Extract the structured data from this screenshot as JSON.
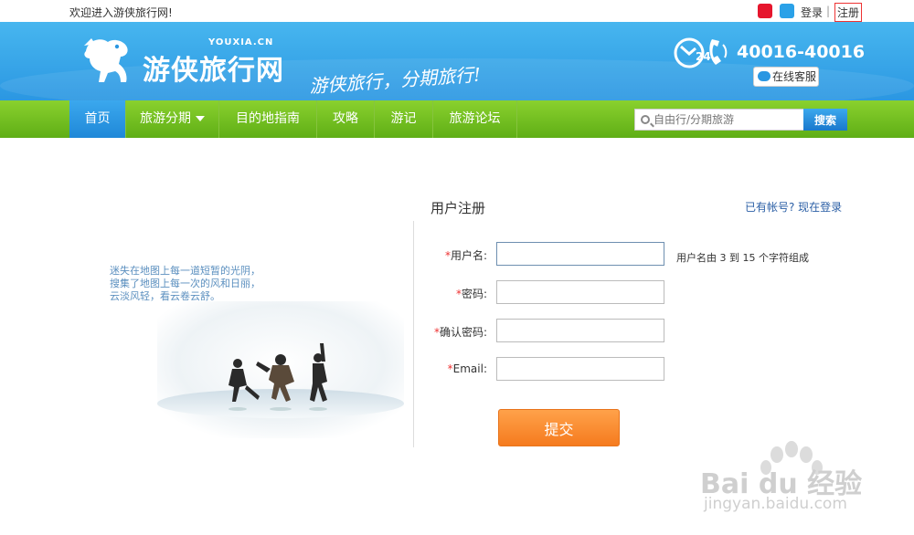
{
  "topbar": {
    "welcome": "欢迎进入游侠旅行网!",
    "login": "登录",
    "separator": "|",
    "register": "注册"
  },
  "header": {
    "logo_sub": "YOUXIA.CN",
    "logo_text": "游侠旅行网",
    "slogan": "游侠旅行，分期旅行!",
    "phone": "40016-40016",
    "phone_badge": "24",
    "service": "在线客服"
  },
  "nav": {
    "items": [
      "首页",
      "旅游分期",
      "目的地指南",
      "攻略",
      "游记",
      "旅游论坛"
    ],
    "search_placeholder": "自由行/分期旅游",
    "search_button": "搜索"
  },
  "promo": {
    "lines": [
      "迷失在地图上每一道短暂的光阴，",
      "搜集了地图上每一次的风和日丽，",
      "云淡风轻，看云卷云舒。"
    ]
  },
  "form": {
    "title": "用户注册",
    "has_account": "已有帐号? 现在登录",
    "required_mark": "*",
    "fields": [
      {
        "label": "用户名:",
        "value": "",
        "hint": "用户名由 3 到 15 个字符组成"
      },
      {
        "label": "密码:",
        "value": ""
      },
      {
        "label": "确认密码:",
        "value": ""
      },
      {
        "label": "Email:",
        "value": ""
      }
    ],
    "submit": "提交"
  },
  "watermark": {
    "text": "Bai du 经验",
    "url": "jingyan.baidu.com"
  },
  "colors": {
    "header_blue": "#2b97e2",
    "nav_green": "#6fbd1e",
    "submit_orange": "#f57b1e",
    "required_red": "#e33333"
  }
}
